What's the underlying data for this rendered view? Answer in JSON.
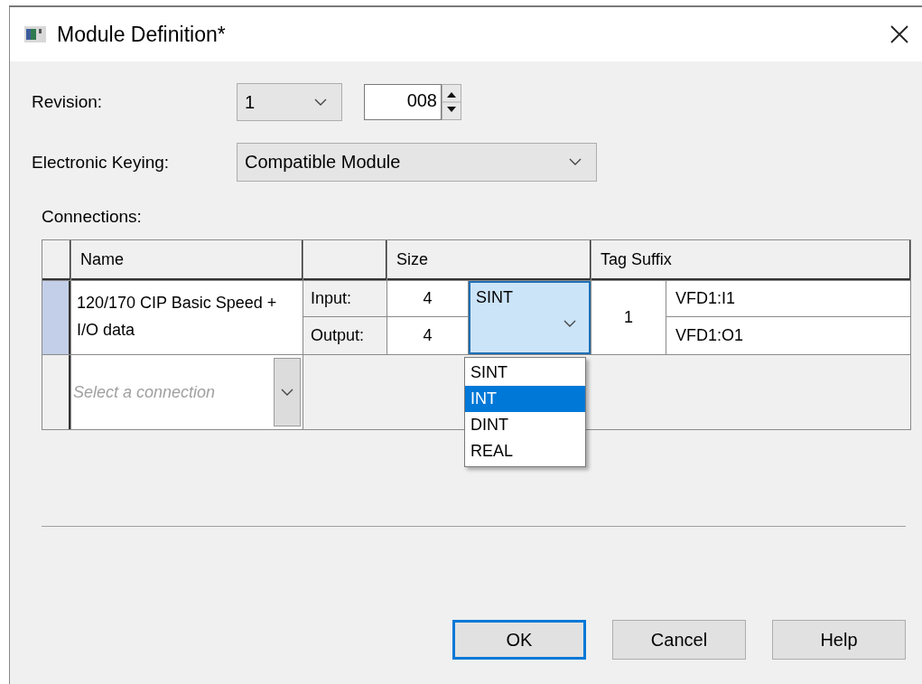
{
  "window": {
    "title": "Module Definition*"
  },
  "revision": {
    "label": "Revision:",
    "major": "1",
    "minor": "008"
  },
  "electronic_keying": {
    "label": "Electronic Keying:",
    "value": "Compatible Module"
  },
  "connections": {
    "label": "Connections:",
    "columns": [
      "Name",
      "Size",
      "Tag Suffix"
    ],
    "rows": [
      {
        "selected": true,
        "name": "120/170 CIP Basic Speed + I/O data",
        "input_label": "Input:",
        "input_size": "4",
        "output_label": "Output:",
        "output_size": "4",
        "data_type": "SINT",
        "tag_count": "1",
        "input_tag": "VFD1:I1",
        "output_tag": "VFD1:O1"
      }
    ],
    "new_row": {
      "placeholder": "Select a connection"
    },
    "type_dropdown": {
      "options": [
        {
          "label": "SINT",
          "selected": false
        },
        {
          "label": "INT",
          "selected": true
        },
        {
          "label": "DINT",
          "selected": false
        },
        {
          "label": "REAL",
          "selected": false
        }
      ]
    }
  },
  "buttons": [
    {
      "label": "OK",
      "default": true
    },
    {
      "label": "Cancel",
      "default": false
    },
    {
      "label": "Help",
      "default": false
    }
  ]
}
